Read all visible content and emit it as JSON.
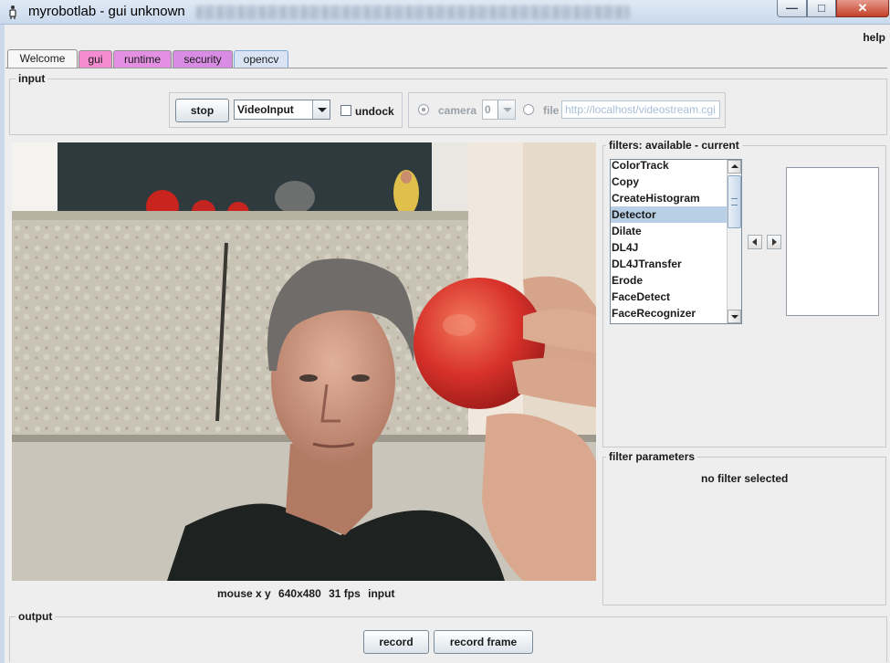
{
  "window": {
    "title": "myrobotlab - gui unknown",
    "buttons": {
      "minimize": "—",
      "maximize": "□",
      "close": "✕"
    }
  },
  "menu": {
    "help": "help"
  },
  "tabs": [
    {
      "label": "Welcome",
      "color": "#f7f7f7",
      "selected": true
    },
    {
      "label": "gui",
      "color": "#f58bd0"
    },
    {
      "label": "runtime",
      "color": "#e38fe2"
    },
    {
      "label": "security",
      "color": "#d98ce3"
    },
    {
      "label": "opencv",
      "color": "#d8e4f3"
    }
  ],
  "input": {
    "title": "input",
    "stop_label": "stop",
    "source_select": "VideoInput",
    "undock_label": "undock",
    "undock_checked": false,
    "camera_label": "camera",
    "camera_index": "0",
    "camera_selected": true,
    "file_label": "file",
    "file_value": "http://localhost/videostream.cgi"
  },
  "video": {
    "status": {
      "mouse": "mouse x y",
      "resolution": "640x480",
      "fps": "31 fps",
      "mode": "input"
    }
  },
  "filters": {
    "title": "filters: available - current",
    "available": [
      "ColorTrack",
      "Copy",
      "CreateHistogram",
      "Detector",
      "Dilate",
      "DL4J",
      "DL4JTransfer",
      "Erode",
      "FaceDetect",
      "FaceRecognizer"
    ],
    "selected": "Detector",
    "current": []
  },
  "filter_parameters": {
    "title": "filter parameters",
    "message": "no filter selected"
  },
  "output": {
    "title": "output",
    "record_label": "record",
    "record_frame_label": "record frame"
  }
}
